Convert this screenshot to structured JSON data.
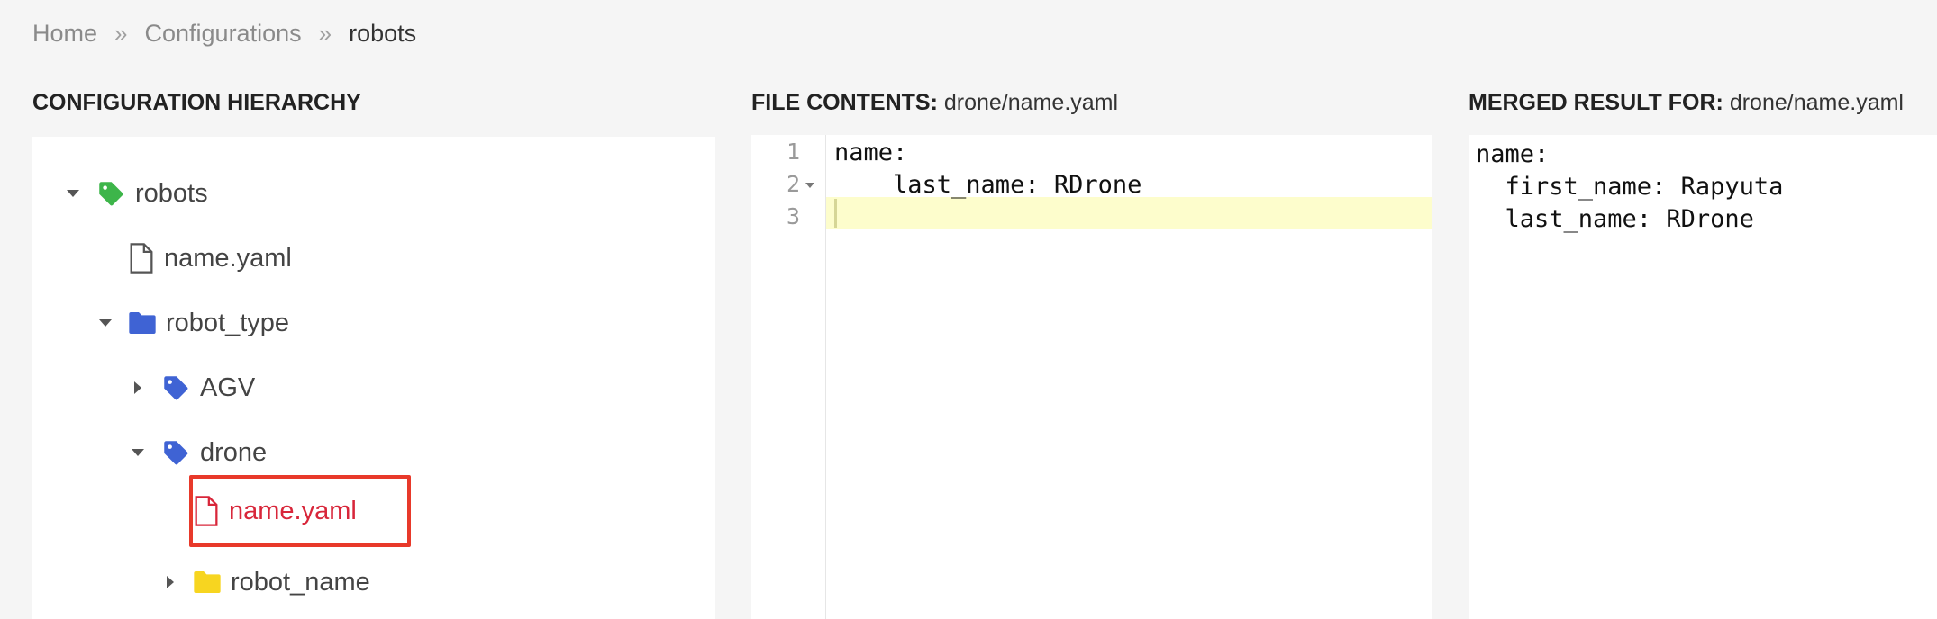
{
  "breadcrumb": {
    "items": [
      "Home",
      "Configurations",
      "robots"
    ],
    "separator": "»"
  },
  "hierarchy": {
    "title": "CONFIGURATION HIERARCHY",
    "nodes": [
      {
        "label": "robots",
        "icon": "tag-icon",
        "color": "#3db54a"
      },
      {
        "label": "name.yaml",
        "icon": "file-icon"
      },
      {
        "label": "robot_type",
        "icon": "folder-icon",
        "color": "#3f63d4"
      },
      {
        "label": "AGV",
        "icon": "tag-icon",
        "color": "#3f63d4"
      },
      {
        "label": "drone",
        "icon": "tag-icon",
        "color": "#3f63d4"
      },
      {
        "label": "name.yaml",
        "icon": "file-icon",
        "selected": true,
        "color": "#d8263a"
      },
      {
        "label": "robot_name",
        "icon": "folder-icon",
        "color": "#f7d520"
      }
    ]
  },
  "file_contents": {
    "title_prefix": "FILE CONTENTS:",
    "file": "drone/name.yaml",
    "line_numbers": [
      "1",
      "2",
      "3"
    ],
    "lines": [
      "name:",
      "    last_name: RDrone",
      ""
    ]
  },
  "merged": {
    "title_prefix": "MERGED RESULT FOR:",
    "file": "drone/name.yaml",
    "lines": [
      "name:",
      "  first_name: Rapyuta",
      "  last_name: RDrone"
    ]
  }
}
